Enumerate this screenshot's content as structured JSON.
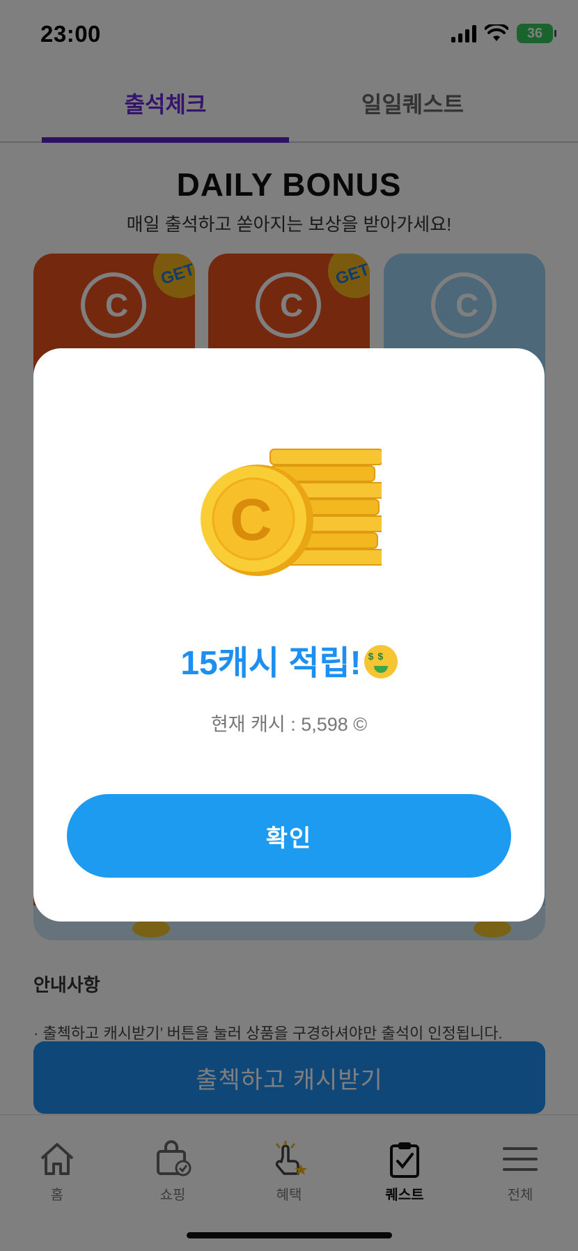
{
  "status_bar": {
    "time": "23:00",
    "battery": "36"
  },
  "tabs": [
    {
      "label": "출석체크",
      "active": true
    },
    {
      "label": "일일퀘스트",
      "active": false
    }
  ],
  "page": {
    "title": "DAILY BONUS",
    "subtitle": "매일 출석하고 쏟아지는 보상을 받아가세요!",
    "badge_label": "GET",
    "notice_title": "안내사항",
    "notice_text": "· 출첵하고 캐시받기’ 버튼을 눌러 상품을 구경하셔야만 출석이 인정됩니다.",
    "cta_label": "출첵하고 캐시받기"
  },
  "bottom_nav": [
    {
      "label": "홈",
      "icon": "home-icon"
    },
    {
      "label": "쇼핑",
      "icon": "shopping-bag-icon"
    },
    {
      "label": "혜택",
      "icon": "tap-star-icon"
    },
    {
      "label": "퀘스트",
      "icon": "clipboard-check-icon",
      "active": true
    },
    {
      "label": "전체",
      "icon": "menu-icon"
    }
  ],
  "modal": {
    "title": "15캐시 적립!",
    "balance": "현재 캐시 : 5,598 ©",
    "confirm_label": "확인"
  },
  "colors": {
    "accent_purple": "#5a22c9",
    "primary_blue": "#1d9bf0",
    "card_orange": "#e9521c",
    "card_blue": "#9bd0f0",
    "coin_gold": "#f6b51b"
  }
}
